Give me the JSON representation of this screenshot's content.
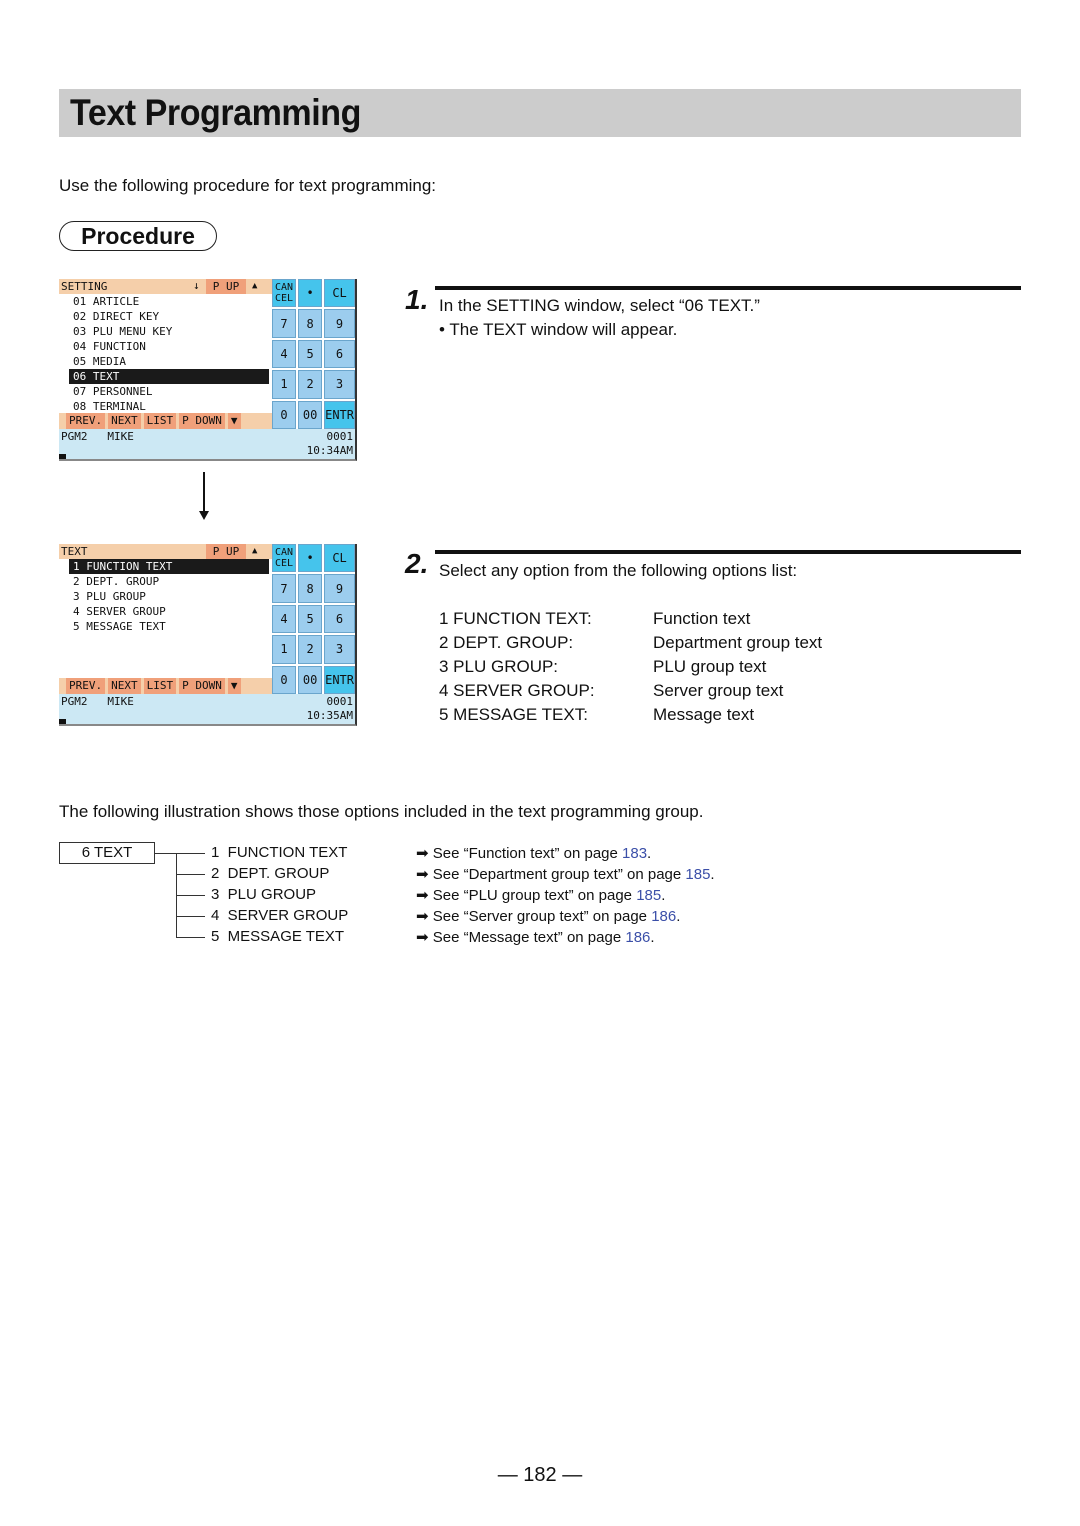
{
  "page": {
    "title": "Text Programming",
    "intro": "Use the following procedure for text programming:",
    "procedure_label": "Procedure",
    "page_number": "— 182 —"
  },
  "screen1": {
    "title": "SETTING",
    "scroll_down_icon": "↓",
    "page_up": "P UP",
    "up_icon": "▲",
    "items": [
      "01 ARTICLE",
      "02 DIRECT KEY",
      "03 PLU MENU KEY",
      "04 FUNCTION",
      "05 MEDIA",
      "06 TEXT",
      "07 PERSONNEL",
      "08 TERMINAL"
    ],
    "selected_index": 5,
    "footer": [
      "PREV.",
      "NEXT",
      "LIST",
      "P DOWN",
      "▼"
    ],
    "operator": "PGM2   MIKE",
    "number": "0001",
    "time": "10:34AM"
  },
  "screen2": {
    "title": "TEXT",
    "page_up": "P UP",
    "up_icon": "▲",
    "items": [
      "1 FUNCTION TEXT",
      "2 DEPT. GROUP",
      "3 PLU GROUP",
      "4 SERVER GROUP",
      "5 MESSAGE TEXT"
    ],
    "selected_index": 0,
    "footer": [
      "PREV.",
      "NEXT",
      "LIST",
      "P DOWN",
      "▼"
    ],
    "operator": "PGM2   MIKE",
    "number": "0001",
    "time": "10:35AM"
  },
  "keypad": [
    "CAN CEL",
    "•",
    "CL",
    "7",
    "8",
    "9",
    "4",
    "5",
    "6",
    "1",
    "2",
    "3",
    "0",
    "00",
    "ENTR"
  ],
  "steps": [
    {
      "num": "1.",
      "text": "In the SETTING window, select “06 TEXT.”",
      "sub": "• The TEXT window will appear."
    },
    {
      "num": "2.",
      "text": "Select any option from the following options list:"
    }
  ],
  "options": [
    {
      "key": "1 FUNCTION TEXT:",
      "desc": "Function text"
    },
    {
      "key": "2 DEPT. GROUP:",
      "desc": "Department group text"
    },
    {
      "key": "3 PLU GROUP:",
      "desc": "PLU group text"
    },
    {
      "key": "4 SERVER GROUP:",
      "desc": "Server group text"
    },
    {
      "key": "5 MESSAGE TEXT:",
      "desc": "Message text"
    }
  ],
  "illustration": {
    "caption": "The following illustration shows those options included in the text programming group.",
    "root": "6 TEXT",
    "items": [
      {
        "label": "1  FUNCTION TEXT",
        "ref": "➡ See “Function text” on page ",
        "page": "183",
        "end": "."
      },
      {
        "label": "2  DEPT. GROUP",
        "ref": "➡ See “Department group text” on page ",
        "page": "185",
        "end": "."
      },
      {
        "label": "3  PLU GROUP",
        "ref": "➡ See “PLU group text” on page ",
        "page": "185",
        "end": "."
      },
      {
        "label": "4  SERVER GROUP",
        "ref": "➡ See “Server group text” on page ",
        "page": "186",
        "end": "."
      },
      {
        "label": "5  MESSAGE TEXT",
        "ref": "➡ See “Message text” on page ",
        "page": "186",
        "end": "."
      }
    ]
  }
}
